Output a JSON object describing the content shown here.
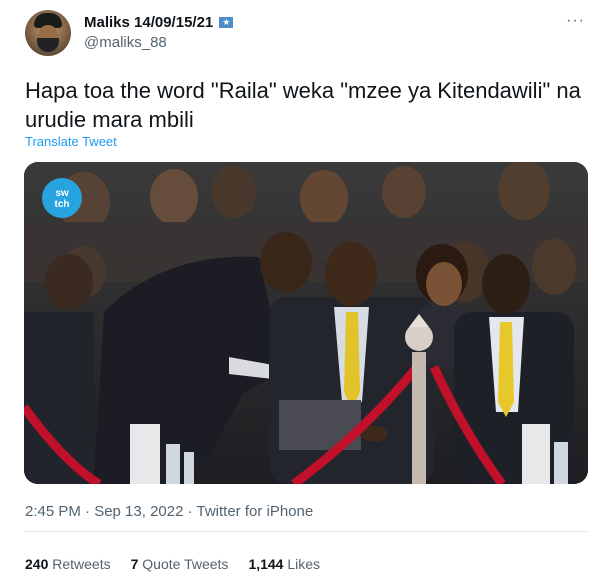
{
  "author": {
    "display_name": "Maliks 14/09/15/21",
    "flag_glyph": "★",
    "handle": "@maliks_88"
  },
  "tweet": {
    "text": "Hapa toa the word \"Raila\" weka \"mzee ya Kitendawili\" na urudie mara mbili",
    "translate_label": "Translate Tweet",
    "more_glyph": "···"
  },
  "media": {
    "watermark": "switch"
  },
  "meta": {
    "timestamp": "2:45 PM · Sep 13, 2022 · Twitter for iPhone"
  },
  "stats": {
    "retweets_count": "240",
    "retweets_label": "Retweets",
    "quotes_count": "7",
    "quotes_label": "Quote Tweets",
    "likes_count": "1,144",
    "likes_label": "Likes"
  },
  "colors": {
    "link": "#1d9bf0",
    "secondary_text": "#536471",
    "rope": "#c0102a"
  }
}
